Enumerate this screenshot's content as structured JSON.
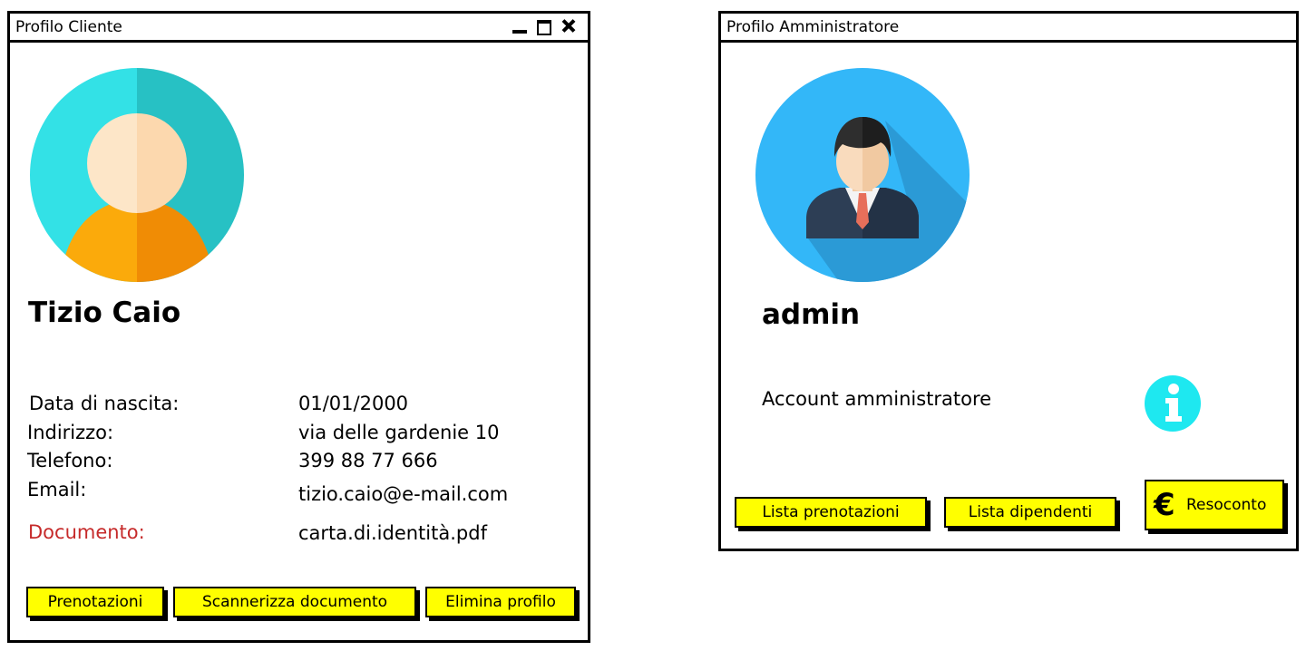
{
  "client_window": {
    "title": "Profilo Cliente",
    "name": "Tizio Caio",
    "fields": [
      {
        "label": "Data di nascita:",
        "value": "01/01/2000"
      },
      {
        "label": "Indirizzo:",
        "value": "via delle gardenie 10"
      },
      {
        "label": "Telefono:",
        "value": "399 88 77 666"
      },
      {
        "label": "Email:",
        "value": "tizio.caio@e-mail.com"
      },
      {
        "label": "Documento:",
        "value": "carta.di.identità.pdf"
      }
    ],
    "buttons": {
      "bookings": "Prenotazioni",
      "scan": "Scannerizza documento",
      "delete": "Elimina profilo"
    }
  },
  "admin_window": {
    "title": "Profilo Amministratore",
    "name": "admin",
    "description": "Account amministratore",
    "buttons": {
      "bookings_list": "Lista prenotazioni",
      "employees_list": "Lista dipendenti",
      "report": "Resoconto"
    }
  },
  "colors": {
    "button_fill": "#ffff00",
    "document_label": "#c62a2a",
    "info_icon": "#1ee8f0",
    "client_avatar_bg": "#33e1e6",
    "admin_avatar_bg": "#33b7f8"
  },
  "icons": {
    "client_avatar": "user-avatar-icon",
    "admin_avatar": "businessman-avatar-icon",
    "info": "info-icon",
    "euro": "euro-icon"
  }
}
